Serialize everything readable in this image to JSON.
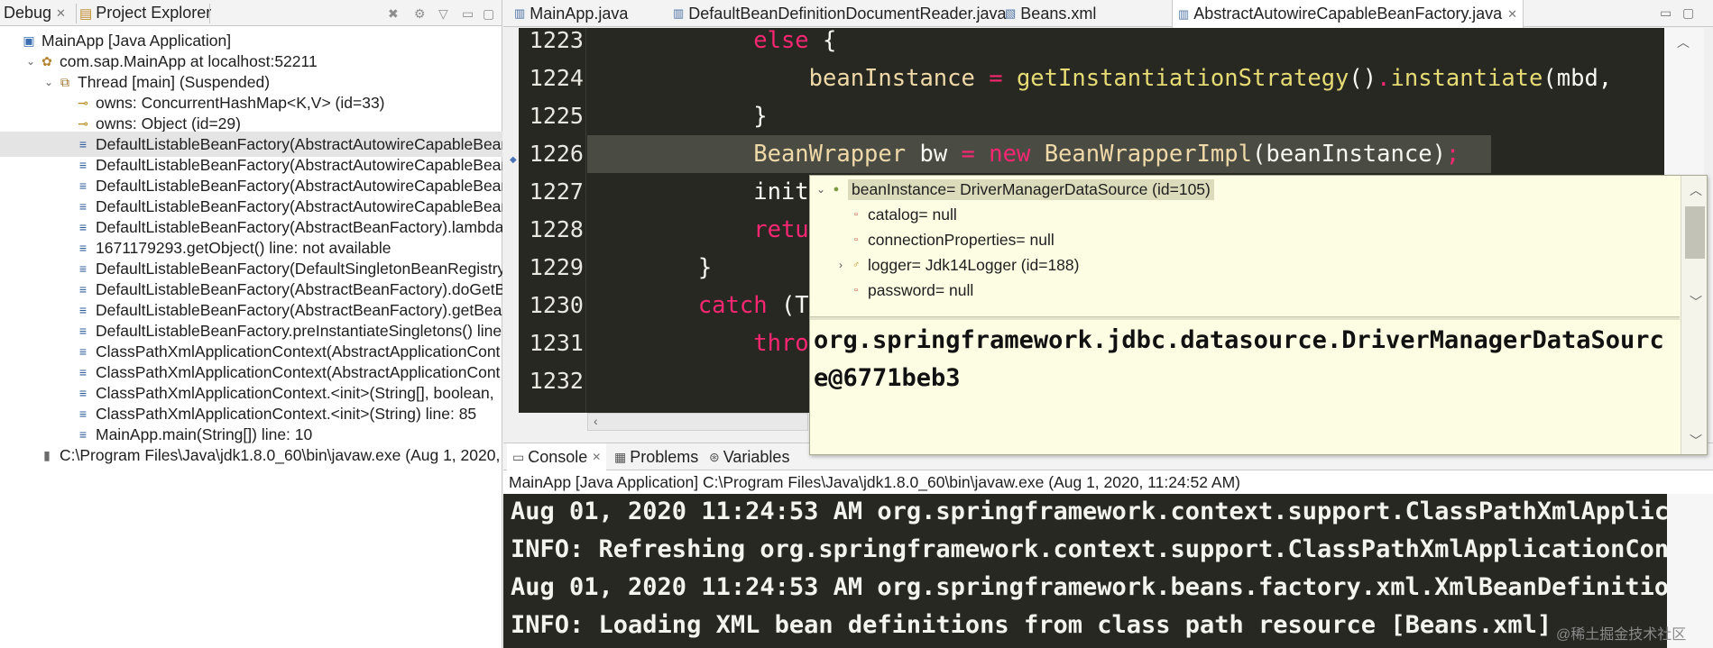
{
  "left_tabs": [
    {
      "label": "Debug"
    },
    {
      "label": "Project Explorer"
    }
  ],
  "debug_tree": [
    {
      "text": "MainApp [Java Application]",
      "icon": "java-app-icon",
      "indent": 0,
      "twisty": "",
      "selected": false
    },
    {
      "text": "com.sap.MainApp at localhost:52211",
      "icon": "debug-target-icon",
      "indent": 1,
      "twisty": "expanded",
      "selected": false
    },
    {
      "text": "Thread [main] (Suspended)",
      "icon": "suspended-thread-icon",
      "indent": 2,
      "twisty": "expanded",
      "selected": false
    },
    {
      "text": "owns: ConcurrentHashMap<K,V>  (id=33)",
      "icon": "monitor-key-icon",
      "indent": 3,
      "twisty": "",
      "selected": false
    },
    {
      "text": "owns: Object  (id=29)",
      "icon": "monitor-key-icon",
      "indent": 3,
      "twisty": "",
      "selected": false
    },
    {
      "text": "DefaultListableBeanFactory(AbstractAutowireCapableBean",
      "icon": "stack-frame-icon",
      "indent": 3,
      "twisty": "",
      "selected": true
    },
    {
      "text": "DefaultListableBeanFactory(AbstractAutowireCapableBean",
      "icon": "stack-frame-icon",
      "indent": 3,
      "twisty": "",
      "selected": false
    },
    {
      "text": "DefaultListableBeanFactory(AbstractAutowireCapableBean",
      "icon": "stack-frame-icon",
      "indent": 3,
      "twisty": "",
      "selected": false
    },
    {
      "text": "DefaultListableBeanFactory(AbstractAutowireCapableBean",
      "icon": "stack-frame-icon",
      "indent": 3,
      "twisty": "",
      "selected": false
    },
    {
      "text": "DefaultListableBeanFactory(AbstractBeanFactory).lambda$",
      "icon": "stack-frame-icon",
      "indent": 3,
      "twisty": "",
      "selected": false
    },
    {
      "text": "1671179293.getObject() line: not available",
      "icon": "stack-frame-icon",
      "indent": 3,
      "twisty": "",
      "selected": false
    },
    {
      "text": "DefaultListableBeanFactory(DefaultSingletonBeanRegistry)",
      "icon": "stack-frame-icon",
      "indent": 3,
      "twisty": "",
      "selected": false
    },
    {
      "text": "DefaultListableBeanFactory(AbstractBeanFactory).doGetBe",
      "icon": "stack-frame-icon",
      "indent": 3,
      "twisty": "",
      "selected": false
    },
    {
      "text": "DefaultListableBeanFactory(AbstractBeanFactory).getBean",
      "icon": "stack-frame-icon",
      "indent": 3,
      "twisty": "",
      "selected": false
    },
    {
      "text": "DefaultListableBeanFactory.preInstantiateSingletons() line:",
      "icon": "stack-frame-icon",
      "indent": 3,
      "twisty": "",
      "selected": false
    },
    {
      "text": "ClassPathXmlApplicationContext(AbstractApplicationCont",
      "icon": "stack-frame-icon",
      "indent": 3,
      "twisty": "",
      "selected": false
    },
    {
      "text": "ClassPathXmlApplicationContext(AbstractApplicationCont",
      "icon": "stack-frame-icon",
      "indent": 3,
      "twisty": "",
      "selected": false
    },
    {
      "text": "ClassPathXmlApplicationContext.<init>(String[], boolean,",
      "icon": "stack-frame-icon",
      "indent": 3,
      "twisty": "",
      "selected": false
    },
    {
      "text": "ClassPathXmlApplicationContext.<init>(String) line: 85",
      "icon": "stack-frame-icon",
      "indent": 3,
      "twisty": "",
      "selected": false
    },
    {
      "text": "MainApp.main(String[]) line: 10",
      "icon": "stack-frame-icon",
      "indent": 3,
      "twisty": "",
      "selected": false
    },
    {
      "text": "C:\\Program Files\\Java\\jdk1.8.0_60\\bin\\javaw.exe (Aug 1, 2020, 1",
      "icon": "process-icon",
      "indent": 1,
      "twisty": "",
      "selected": false
    }
  ],
  "editor_tabs": [
    {
      "label": "MainApp.java",
      "icon": "java-file-icon",
      "active": false
    },
    {
      "label": "DefaultBeanDefinitionDocumentReader.java",
      "icon": "java-file-icon",
      "active": false
    },
    {
      "label": "Beans.xml",
      "icon": "xml-file-icon",
      "active": false
    },
    {
      "label": "AbstractAutowireCapableBeanFactory.java",
      "icon": "java-file-icon",
      "active": true
    }
  ],
  "code_lines": [
    {
      "num": "1223",
      "highlight": false,
      "tokens": [
        {
          "t": "            ",
          "c": ""
        },
        {
          "t": "else",
          "c": "kw"
        },
        {
          "t": " {",
          "c": ""
        }
      ]
    },
    {
      "num": "1224",
      "highlight": false,
      "tokens": [
        {
          "t": "                ",
          "c": ""
        },
        {
          "t": "beanInstance",
          "c": "ty"
        },
        {
          "t": " ",
          "c": ""
        },
        {
          "t": "=",
          "c": "kw"
        },
        {
          "t": " ",
          "c": ""
        },
        {
          "t": "getInstantiationStrategy",
          "c": "fn"
        },
        {
          "t": "()",
          "c": ""
        },
        {
          "t": ".",
          "c": "kw"
        },
        {
          "t": "instantiate",
          "c": "fn"
        },
        {
          "t": "(mbd,",
          "c": ""
        }
      ]
    },
    {
      "num": "1225",
      "highlight": false,
      "tokens": [
        {
          "t": "            }",
          "c": ""
        }
      ]
    },
    {
      "num": "1226",
      "highlight": true,
      "tokens": [
        {
          "t": "            ",
          "c": ""
        },
        {
          "t": "BeanWrapper",
          "c": "ty"
        },
        {
          "t": " bw ",
          "c": ""
        },
        {
          "t": "=",
          "c": "kw"
        },
        {
          "t": " ",
          "c": ""
        },
        {
          "t": "new",
          "c": "kw"
        },
        {
          "t": " ",
          "c": ""
        },
        {
          "t": "BeanWrapperImpl",
          "c": "ty"
        },
        {
          "t": "(beanInstance)",
          "c": ""
        },
        {
          "t": ";",
          "c": "kw"
        }
      ]
    },
    {
      "num": "1227",
      "highlight": false,
      "tokens": [
        {
          "t": "            init",
          "c": ""
        }
      ]
    },
    {
      "num": "1228",
      "highlight": false,
      "tokens": [
        {
          "t": "            ",
          "c": ""
        },
        {
          "t": "retu",
          "c": "kw"
        }
      ]
    },
    {
      "num": "1229",
      "highlight": false,
      "tokens": [
        {
          "t": "        }",
          "c": ""
        }
      ]
    },
    {
      "num": "1230",
      "highlight": false,
      "tokens": [
        {
          "t": "        ",
          "c": ""
        },
        {
          "t": "catch",
          "c": "kw"
        },
        {
          "t": " (T",
          "c": ""
        }
      ]
    },
    {
      "num": "1231",
      "highlight": false,
      "tokens": [
        {
          "t": "            ",
          "c": ""
        },
        {
          "t": "thro",
          "c": "kw"
        }
      ]
    },
    {
      "num": "1232",
      "highlight": false,
      "tokens": []
    }
  ],
  "console_tabs": [
    {
      "label": "Console",
      "icon": "console-icon",
      "active": true
    },
    {
      "label": "Problems",
      "icon": "problems-icon",
      "active": false
    },
    {
      "label": "Variables",
      "icon": "variables-icon",
      "active": false
    }
  ],
  "console_info": "MainApp [Java Application] C:\\Program Files\\Java\\jdk1.8.0_60\\bin\\javaw.exe (Aug 1, 2020, 11:24:52 AM)",
  "console_lines": [
    "Aug 01, 2020 11:24:53 AM org.springframework.context.support.ClassPathXmlApplica",
    "INFO: Refreshing org.springframework.context.support.ClassPathXmlApplicationCont",
    "Aug 01, 2020 11:24:53 AM org.springframework.beans.factory.xml.XmlBeanDefinition",
    "INFO: Loading XML bean definitions from class path resource [Beans.xml]"
  ],
  "popup": {
    "rows": [
      {
        "text": "beanInstance= DriverManagerDataSource  (id=105)",
        "icon": "local-variable-icon",
        "indent": 0,
        "twisty": "expanded",
        "selected": true
      },
      {
        "text": "catalog= null",
        "icon": "field-icon",
        "indent": 1,
        "twisty": "",
        "selected": false
      },
      {
        "text": "connectionProperties= null",
        "icon": "field-icon",
        "indent": 1,
        "twisty": "",
        "selected": false
      },
      {
        "text": "logger= Jdk14Logger  (id=188)",
        "icon": "static-field-icon",
        "indent": 1,
        "twisty": "collapsed",
        "selected": false
      },
      {
        "text": "password= null",
        "icon": "field-icon",
        "indent": 1,
        "twisty": "",
        "selected": false
      }
    ],
    "detail": "org.springframework.jdbc.datasource.DriverManagerDataSource@6771beb3"
  },
  "watermark": "@稀土掘金技术社区"
}
